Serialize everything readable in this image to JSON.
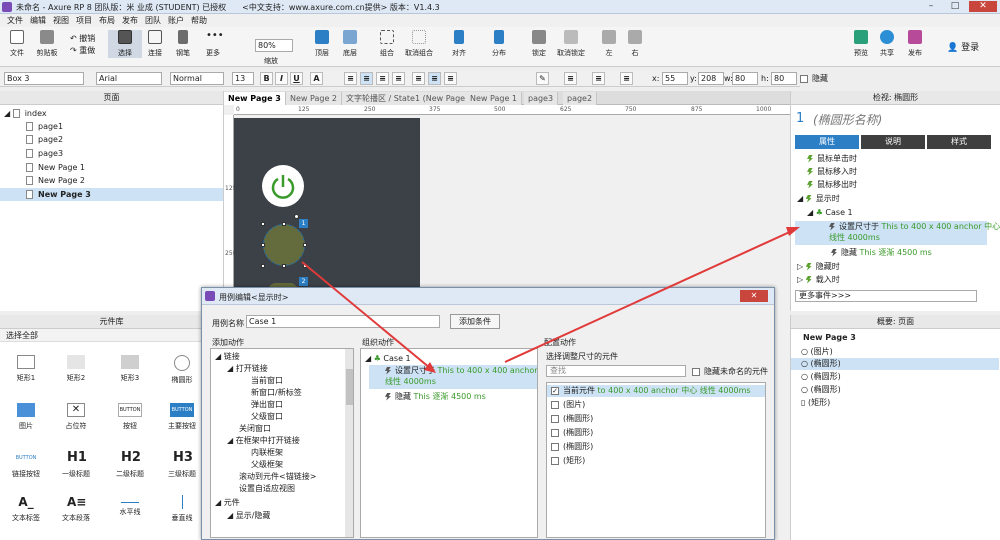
{
  "window": {
    "title": "未命名 - Axure RP 8 团队版：米 业成 (STUDENT) 已授权　　<中文支持：www.axure.com.cn提供> 版本：V1.4.3"
  },
  "menu": [
    "文件",
    "编辑",
    "视图",
    "项目",
    "布局",
    "发布",
    "团队",
    "账户",
    "帮助"
  ],
  "toolbar": {
    "file": "文件",
    "clipboard": "剪贴板",
    "undo": "撤销",
    "redo": "重做",
    "select": "选择",
    "connect": "连接",
    "pen": "钢笔",
    "more": "更多",
    "zoom": "80%",
    "zoom_label": "缩放",
    "top": "顶层",
    "bottom": "底层",
    "group": "组合",
    "ungroup": "取消组合",
    "align": "对齐",
    "distribute": "分布",
    "lock": "锁定",
    "unlock": "取消锁定",
    "left": "左",
    "right": "右",
    "preview": "预览",
    "share": "共享",
    "publish": "发布",
    "login": "登录"
  },
  "format": {
    "widget": "Box 3",
    "font": "Arial",
    "style": "Normal",
    "size": "13",
    "x_label": "x:",
    "x": "55",
    "y_label": "y:",
    "y": "208",
    "w_label": "w:",
    "w": "80",
    "h_label": "h:",
    "h": "80",
    "hidden": "隐藏"
  },
  "pages": {
    "title": "页面",
    "items": [
      "index",
      "page1",
      "page2",
      "page3",
      "New Page 1",
      "New Page 2",
      "New Page 3"
    ]
  },
  "library": {
    "title": "元件库",
    "select": "选择全部",
    "widgets": [
      "矩形1",
      "矩形2",
      "矩形3",
      "椭圆形",
      "图片",
      "占位符",
      "按钮",
      "主要按钮",
      "链接按钮",
      "一级标题",
      "二级标题",
      "三级标题",
      "文本标签",
      "文本段落",
      "水平线",
      "垂直线"
    ],
    "h1": "H1",
    "h2": "H2",
    "h3": "H3",
    "btn": "BUTTON"
  },
  "tabs": [
    "New Page 3",
    "New Page 2",
    "文字轮播区 / State1 (New Page 1)",
    "New Page 1",
    "page3",
    "page2"
  ],
  "ruler": {
    "h": [
      "0",
      "125",
      "250",
      "375",
      "500",
      "625",
      "750",
      "875",
      "1000"
    ],
    "v": [
      "125",
      "250"
    ]
  },
  "badges": [
    "1",
    "2"
  ],
  "inspector": {
    "title": "检视: 椭圆形",
    "num": "1",
    "name": "(椭圆形名称)",
    "tabs": [
      "属性",
      "说明",
      "样式"
    ],
    "events": [
      "鼠标单击时",
      "鼠标移入时",
      "鼠标移出时",
      "显示时",
      "Case 1",
      "设置尺寸于",
      "This to 400 x 400 anchor 中心",
      "线性 4000ms",
      "隐藏",
      "This 逐渐 4500 ms",
      "隐藏时",
      "载入时"
    ],
    "more": "更多事件>>>"
  },
  "outline": {
    "title": "概要: 页面",
    "page": "New Page 3",
    "items": [
      "(图片)",
      "(椭圆形)",
      "(椭圆形)",
      "(椭圆形)",
      "(矩形)"
    ]
  },
  "dialog": {
    "title": "用例编辑<显示时>",
    "case_label": "用例名称",
    "case_name": "Case 1",
    "add_cond": "添加条件",
    "col1": "添加动作",
    "col2": "组织动作",
    "col3": "配置动作",
    "actions": [
      "链接",
      "打开链接",
      "当前窗口",
      "新窗口/新标签",
      "弹出窗口",
      "父级窗口",
      "关闭窗口",
      "在框架中打开链接",
      "内联框架",
      "父级框架",
      "滚动到元件<锚链接>",
      "设置自适应视图",
      "元件",
      "显示/隐藏"
    ],
    "org_case": "Case 1",
    "org1": "设置尺寸于",
    "org1b": "This to 400 x 400 anchor 中心",
    "org1c": "线性 4000ms",
    "org2": "隐藏",
    "org2b": "This 逐渐 4500 ms",
    "cfg_title": "选择调整尺寸的元件",
    "search": "查找",
    "hide_unnamed": "隐藏未命名的元件",
    "cfg_items": [
      "当前元件",
      "to 400 x 400 anchor 中心 线性 4000ms",
      "(图片)",
      "(椭圆形)",
      "(椭圆形)",
      "(椭圆形)",
      "(矩形)"
    ]
  },
  "colors": {
    "accent": "#2c7fc4",
    "green": "#3a9a2a",
    "arrow": "#e03a3a",
    "canvas": "#3c4148"
  }
}
